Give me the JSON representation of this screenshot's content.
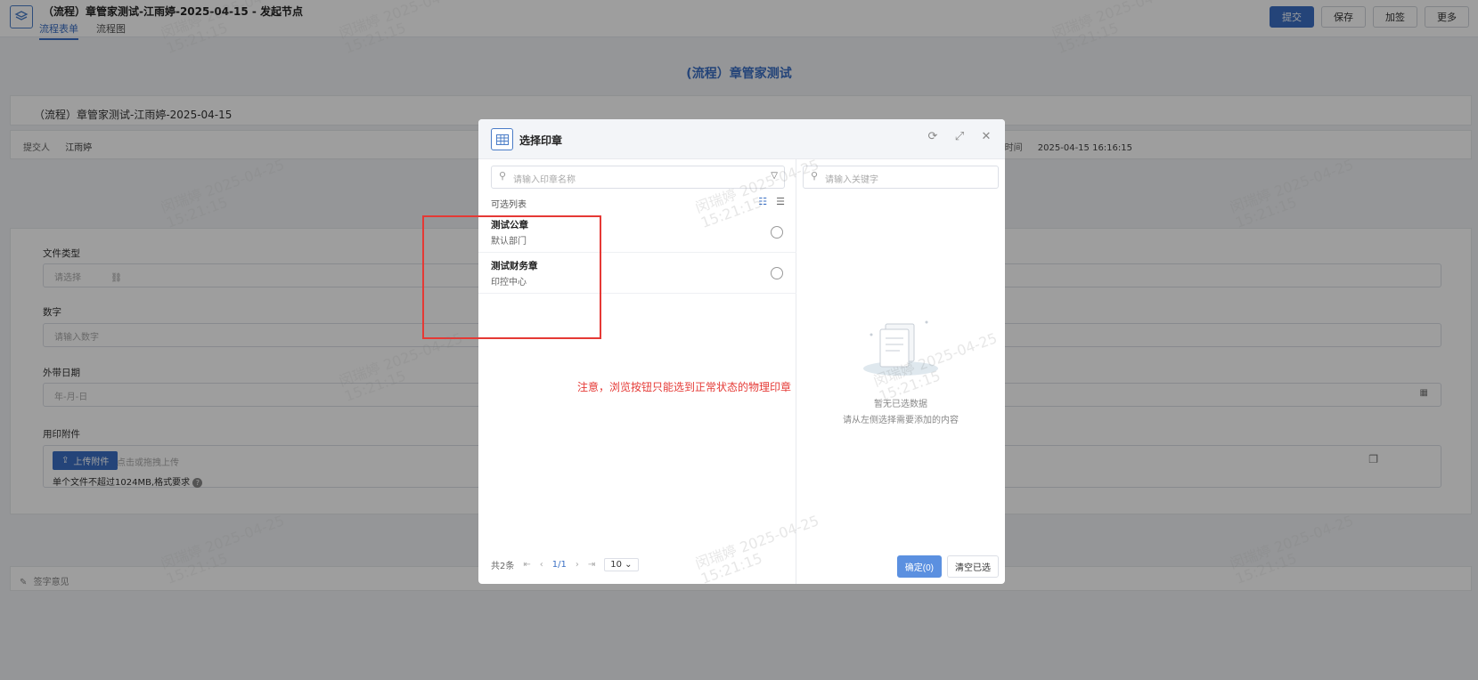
{
  "header": {
    "title": "（流程）章管家测试-江雨婷-2025-04-15 - 发起节点",
    "tabs": [
      "流程表单",
      "流程图"
    ],
    "actions": [
      "提交",
      "保存",
      "加签",
      "更多"
    ]
  },
  "form": {
    "heading": "(流程）章管家测试",
    "flow_title": "（流程）章管家测试-江雨婷-2025-04-15",
    "submitter_label": "提交人",
    "submitter": "江雨婷",
    "submit_time_label": "提交时间",
    "submit_time": "2025-04-15 16:16:15",
    "file_type_label": "文件类型",
    "file_type_placeholder": "请选择",
    "number_label": "数字",
    "number_placeholder": "请输入数字",
    "date_label": "外带日期",
    "date_placeholder": "年-月-日",
    "attach_label": "用印附件",
    "upload_button": "上传附件",
    "upload_hint": "点击或拖拽上传",
    "upload_note": "单个文件不超过1024MB,格式要求",
    "sign_label": "签字意见"
  },
  "modal": {
    "title": "选择印章",
    "search_placeholder": "请输入印章名称",
    "keyword_placeholder": "请输入关键字",
    "list_caption": "可选列表",
    "seals": [
      {
        "name": "测试公章",
        "dept": "默认部门"
      },
      {
        "name": "测试财务章",
        "dept": "印控中心"
      }
    ],
    "pager": {
      "total": "共2条",
      "page": "1/1",
      "size": "10"
    },
    "empty_title": "暂无已选数据",
    "empty_sub": "请从左侧选择需要添加的内容",
    "confirm": "确定(0)",
    "clear": "清空已选"
  },
  "annotation": {
    "note": "注意，浏览按钮只能选到正常状态的物理印章"
  },
  "watermark": {
    "name": "闵瑞婷",
    "date": "2025-04-25",
    "time": "15:21:15"
  },
  "colors": {
    "primary": "#3a6fc4",
    "annotation": "#e53935"
  }
}
